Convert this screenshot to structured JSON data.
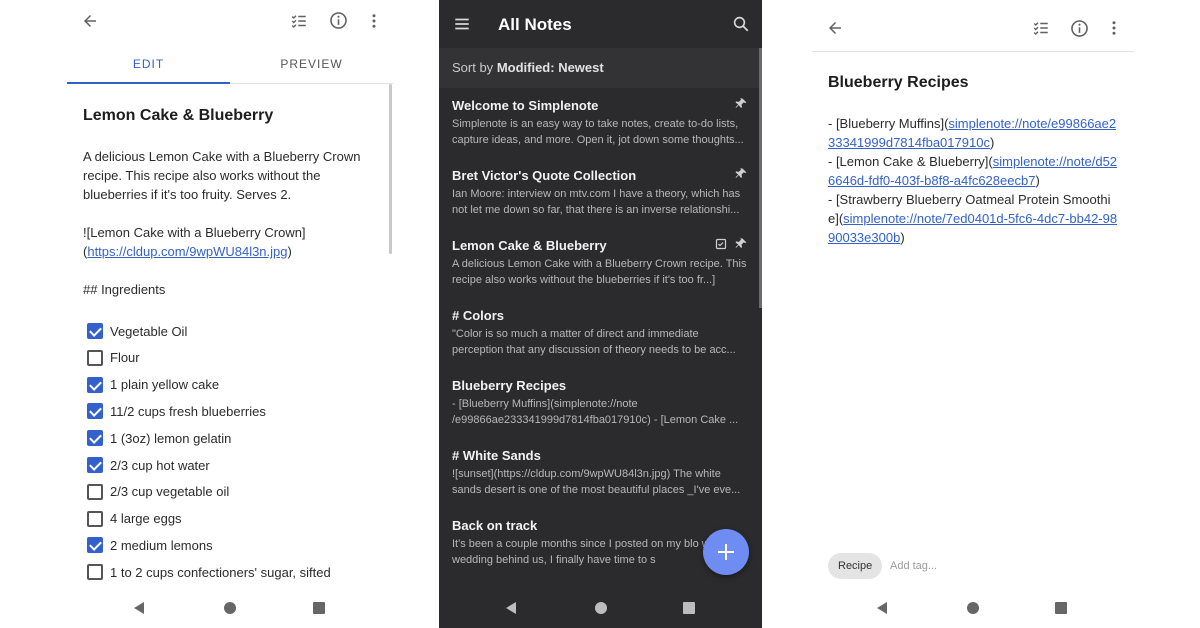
{
  "colors": {
    "accent": "#3361cc",
    "dark_bg": "#2b2b2d",
    "fab": "#6f8cf2"
  },
  "editor": {
    "icons": [
      "back-arrow-icon",
      "checklist-icon",
      "info-icon",
      "more-vert-icon"
    ],
    "tabs": [
      {
        "label": "EDIT",
        "active": true
      },
      {
        "label": "PREVIEW",
        "active": false
      }
    ],
    "title": "Lemon Cake & Blueberry",
    "paragraph": "A delicious Lemon Cake with a Blueberry Crown recipe. This recipe also works without the blueberries if it's too fruity. Serves 2.",
    "image_md_prefix": "![Lemon Cake with a Blueberry Crown](",
    "image_url": "https://cldup.com/9wpWU84l3n.jpg",
    "image_md_suffix": ")",
    "heading": "## Ingredients",
    "checklist": [
      {
        "label": "Vegetable Oil",
        "checked": true
      },
      {
        "label": "Flour",
        "checked": false
      },
      {
        "label": "1 plain yellow cake",
        "checked": true
      },
      {
        "label": "11/2 cups fresh blueberries",
        "checked": true
      },
      {
        "label": "1 (3oz) lemon gelatin",
        "checked": true
      },
      {
        "label": "2/3 cup hot water",
        "checked": true
      },
      {
        "label": "2/3 cup vegetable oil",
        "checked": false
      },
      {
        "label": "4 large eggs",
        "checked": false
      },
      {
        "label": "2 medium lemons",
        "checked": true
      },
      {
        "label": "1 to 2 cups confectioners' sugar, sifted",
        "checked": false
      }
    ]
  },
  "list": {
    "title": "All Notes",
    "sort_prefix": "Sort by",
    "sort_value": "Modified: Newest",
    "notes": [
      {
        "title": "Welcome to Simplenote",
        "preview": "Simplenote is an easy way to take notes, create to-do lists, capture ideas, and more. Open it, jot down some thoughts...",
        "pinned": true,
        "checklist": false
      },
      {
        "title": "Bret Victor's Quote Collection",
        "preview": "Ian Moore: interview on mtv.com I have a theory, which has not let me down so far, that there is an inverse relationshi...",
        "pinned": true,
        "checklist": false
      },
      {
        "title": "Lemon Cake & Blueberry",
        "preview": "A delicious Lemon Cake with a Blueberry Crown recipe. This recipe also works without the blueberries if it's too fr...]",
        "pinned": true,
        "checklist": true
      },
      {
        "title": "# Colors",
        "preview": "\"Color is so much a matter of direct and immediate perception that any discussion of theory needs to be acc...",
        "pinned": false,
        "checklist": false
      },
      {
        "title": "Blueberry Recipes",
        "preview": "- [Blueberry Muffins](simplenote://note /e99866ae233341999d7814fba017910c) - [Lemon Cake ...",
        "pinned": false,
        "checklist": false
      },
      {
        "title": "# White Sands",
        "preview": "![sunset](https://cldup.com/9wpWU84l3n.jpg) The white sands desert is one of the most beautiful places _I've eve...",
        "pinned": false,
        "checklist": false
      },
      {
        "title": "Back on track",
        "preview": "It's been a couple months since I posted on my blo with the wedding behind us, I finally have time to s",
        "pinned": false,
        "checklist": false
      }
    ]
  },
  "detail": {
    "title": "Blueberry Recipes",
    "items": [
      {
        "prefix": "- [Blueberry Muffins](",
        "link": "simplenote://note/e99866ae233341999d7814fba017910c",
        "suffix": ")"
      },
      {
        "prefix": "- [Lemon Cake & Blueberry](",
        "link": "simplenote://note/d526646d-fdf0-403f-b8f8-a4fc628eecb7",
        "suffix": ")"
      },
      {
        "prefix": "- [Strawberry Blueberry Oatmeal Protein Smoothie](",
        "link": "simplenote://note/7ed0401d-5fc6-4dc7-bb42-9890033e300b",
        "suffix": ")"
      }
    ],
    "tag": "Recipe",
    "add_tag_placeholder": "Add tag..."
  }
}
